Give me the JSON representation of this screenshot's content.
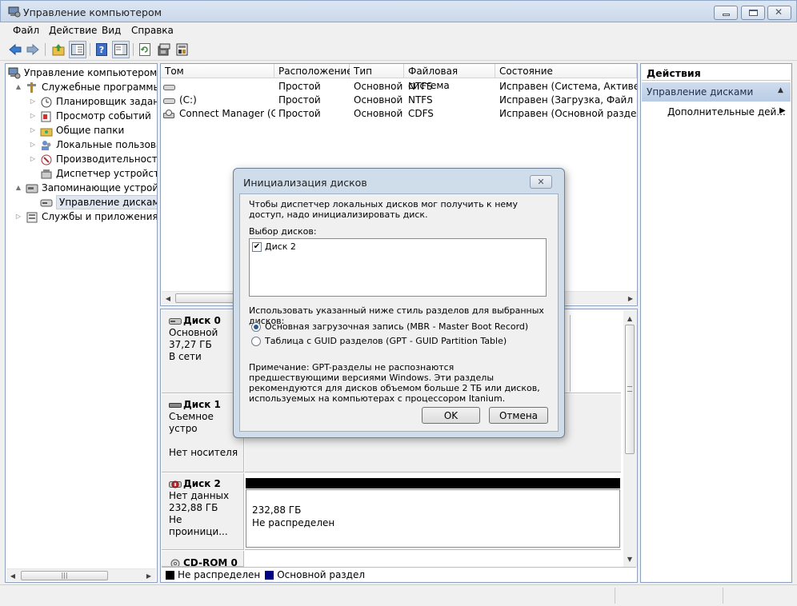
{
  "window": {
    "title": "Управление компьютером"
  },
  "menu": [
    "Файл",
    "Действие",
    "Вид",
    "Справка"
  ],
  "tree": {
    "root": "Управление компьютером (л",
    "items": [
      {
        "label": "Служебные программы",
        "level": 1,
        "expander": "▲"
      },
      {
        "label": "Планировщик заданий",
        "level": 2,
        "expander": "▷"
      },
      {
        "label": "Просмотр событий",
        "level": 2,
        "expander": "▷"
      },
      {
        "label": "Общие папки",
        "level": 2,
        "expander": "▷"
      },
      {
        "label": "Локальные пользовате",
        "level": 2,
        "expander": "▷"
      },
      {
        "label": "Производительность",
        "level": 2,
        "expander": "▷"
      },
      {
        "label": "Диспетчер устройств",
        "level": 2,
        "expander": ""
      },
      {
        "label": "Запоминающие устройст",
        "level": 1,
        "expander": "▲"
      },
      {
        "label": "Управление дисками",
        "level": 2,
        "expander": "",
        "selected": true
      },
      {
        "label": "Службы и приложения",
        "level": 1,
        "expander": "▷"
      }
    ]
  },
  "volumes": {
    "columns": [
      "Том",
      "Расположение",
      "Тип",
      "Файловая система",
      "Состояние"
    ],
    "rows": [
      {
        "name": "",
        "layout": "Простой",
        "type": "Основной",
        "fs": "NTFS",
        "status": "Исправен (Система, Активен, О"
      },
      {
        "name": "(C:)",
        "layout": "Простой",
        "type": "Основной",
        "fs": "NTFS",
        "status": "Исправен (Загрузка, Файл подк"
      },
      {
        "name": "Connect Manager (G:)",
        "layout": "Простой",
        "type": "Основной",
        "fs": "CDFS",
        "status": "Исправен (Основной раздел)"
      }
    ]
  },
  "disks": [
    {
      "name": "Диск 0",
      "line1": "Основной",
      "line2": "37,27 ГБ",
      "line3": "В сети"
    },
    {
      "name": "Диск 1",
      "line1": "Съемное устро",
      "line2": "",
      "line3": "Нет носителя"
    },
    {
      "name": "Диск 2",
      "line1": "Нет данных",
      "line2": "232,88 ГБ",
      "line3": "Не проиници..."
    },
    {
      "name": "CD-ROM 0"
    }
  ],
  "disk2_partition": {
    "size": "232,88 ГБ",
    "state": "Не распределен"
  },
  "legend": [
    {
      "label": "Не распределен",
      "color": "#000000"
    },
    {
      "label": "Основной раздел",
      "color": "#000080"
    }
  ],
  "actions": {
    "header": "Действия",
    "section": "Управление дисками",
    "item": "Дополнительные дей..."
  },
  "dialog": {
    "title": "Инициализация дисков",
    "intro": "Чтобы диспетчер локальных дисков мог получить к нему доступ, надо инициализировать диск.",
    "select_label": "Выбор дисков:",
    "disk_item": "Диск 2",
    "style_label": "Использовать указанный ниже стиль разделов для выбранных дисков:",
    "option_mbr": "Основная загрузочная запись (MBR - Master Boot Record)",
    "option_gpt": "Таблица с GUID разделов (GPT - GUID Partition Table)",
    "selected_option": "mbr",
    "note": "Примечание: GPT-разделы не распознаются предшествующими версиями Windows. Эти разделы рекомендуются для дисков объемом больше 2 ТБ или дисков, используемых на компьютерах с процессором Itanium.",
    "ok": "OK",
    "cancel": "Отмена"
  },
  "scrollbar_grip": "|||"
}
